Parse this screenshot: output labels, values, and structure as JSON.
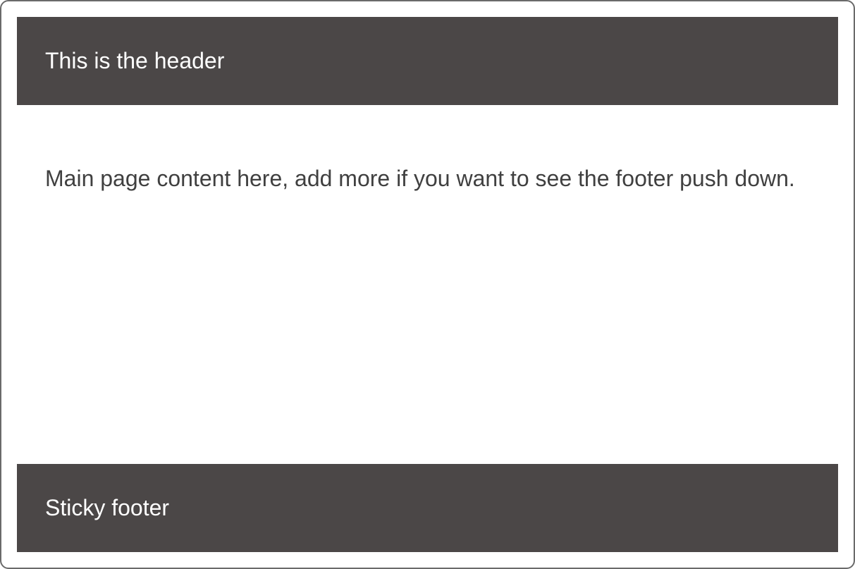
{
  "header": {
    "text": "This is the header"
  },
  "content": {
    "text": "Main page content here, add more if you want to see the footer push down."
  },
  "footer": {
    "text": "Sticky footer"
  }
}
